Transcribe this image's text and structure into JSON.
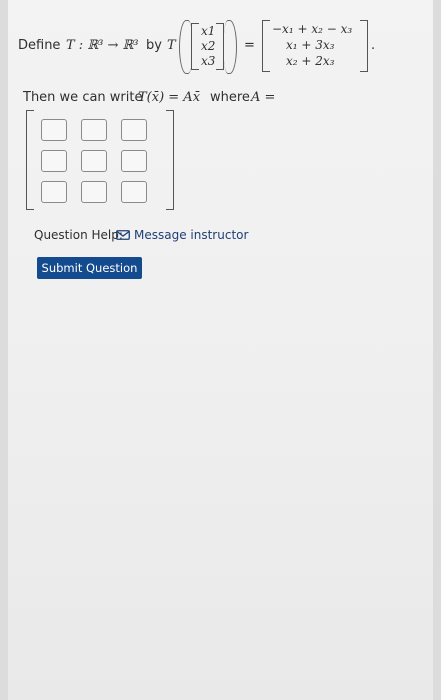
{
  "question": {
    "define_prefix": "Define",
    "map_symbol": "T : ℝ³ → ℝ³",
    "by_word": "by",
    "T_symbol": "T",
    "input_vector": [
      "x1",
      "x2",
      "x3"
    ],
    "equals": "=",
    "output_vector": [
      "−x₁ + x₂ − x₃",
      "x₁ + 3x₃",
      "x₂ + 2x₃"
    ],
    "period": ".",
    "then_text": "Then we can write",
    "formula": "T(x̄) = Ax̄",
    "where_text": "where",
    "A_eq": "A ="
  },
  "matrix_inputs": {
    "rows": 3,
    "cols": 3,
    "values": [
      "",
      "",
      "",
      "",
      "",
      "",
      "",
      "",
      ""
    ]
  },
  "help": {
    "label": "Question Help:",
    "message_link": "Message instructor"
  },
  "submit": {
    "label": "Submit Question"
  },
  "colors": {
    "submit_bg": "#144b8e",
    "link": "#1f3f75"
  }
}
